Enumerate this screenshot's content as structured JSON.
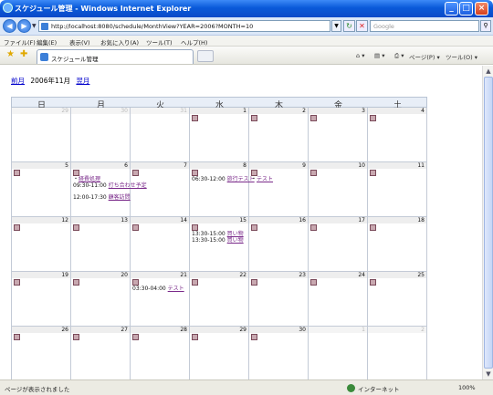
{
  "window": {
    "title": "スケジュール管理 - Windows Internet Explorer",
    "url": "http://localhost:8080/schedule/MonthView?YEAR=2006?MONTH=10",
    "search_placeholder": "Google",
    "tab_label": "スケジュール管理",
    "status": "ページが表示されました",
    "zone": "インターネット",
    "zoom": "100%"
  },
  "menu": [
    "ファイル(F)",
    "編集(E)",
    "表示(V)",
    "お気に入り(A)",
    "ツール(T)",
    "ヘルプ(H)"
  ],
  "commands": {
    "page": "ページ(P)",
    "tools": "ツール(O)"
  },
  "calendar": {
    "prev": "前月",
    "title": "2006年11月",
    "next": "翌月",
    "weekdays": [
      "日",
      "月",
      "火",
      "水",
      "木",
      "金",
      "土"
    ],
    "weeks": [
      [
        {
          "d": "29",
          "other": true
        },
        {
          "d": "30",
          "other": true
        },
        {
          "d": "31",
          "other": true
        },
        {
          "d": "1"
        },
        {
          "d": "2"
        },
        {
          "d": "3"
        },
        {
          "d": "4"
        }
      ],
      [
        {
          "d": "5"
        },
        {
          "d": "6"
        },
        {
          "d": "7"
        },
        {
          "d": "8"
        },
        {
          "d": "9"
        },
        {
          "d": "10"
        },
        {
          "d": "11"
        }
      ],
      [
        {
          "d": "12"
        },
        {
          "d": "13"
        },
        {
          "d": "14"
        },
        {
          "d": "15"
        },
        {
          "d": "16"
        },
        {
          "d": "17"
        },
        {
          "d": "18"
        }
      ],
      [
        {
          "d": "19"
        },
        {
          "d": "20"
        },
        {
          "d": "21"
        },
        {
          "d": "22"
        },
        {
          "d": "23"
        },
        {
          "d": "24"
        },
        {
          "d": "25"
        }
      ],
      [
        {
          "d": "26"
        },
        {
          "d": "27"
        },
        {
          "d": "28"
        },
        {
          "d": "29"
        },
        {
          "d": "30"
        },
        {
          "d": "1",
          "other": true
        },
        {
          "d": "2",
          "other": true
        }
      ]
    ],
    "events": {
      "nov6_a_prefix": "・",
      "nov6_a_title": "経費処理",
      "nov6_b_time": "09:30-11:00",
      "nov6_b_title": "打ち合わせ予定",
      "nov6_c_time": "12:00-17:30",
      "nov6_c_title": "顧客訪問",
      "nov8_time": "06:30-12:00",
      "nov8_title": "旅行テスト",
      "nov9_prefix": "・",
      "nov9_title": "テスト",
      "nov15_a_time": "13:30-15:00",
      "nov15_a_title": "買い物",
      "nov15_b_time": "13:30-15:00",
      "nov15_b_title": "買い物",
      "nov21_time": "03:30-04:00",
      "nov21_title": "テスト"
    }
  }
}
